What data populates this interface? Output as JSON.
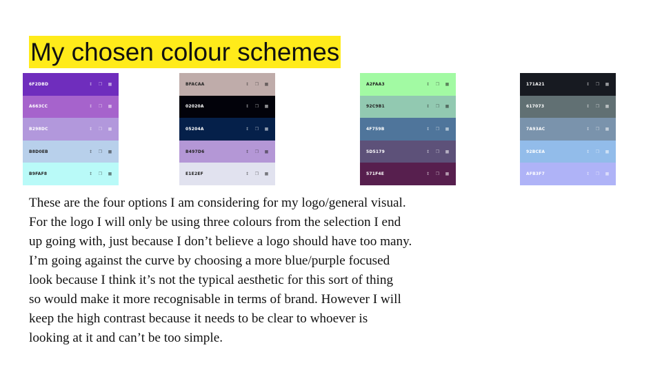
{
  "title": "My chosen colour schemes",
  "palettes": [
    {
      "swatches": [
        {
          "hex": "6F2DBD",
          "color": "#6F2DBD",
          "text": "#ffffff"
        },
        {
          "hex": "A663CC",
          "color": "#A663CC",
          "text": "#ffffff"
        },
        {
          "hex": "B298DC",
          "color": "#B298DC",
          "text": "#ffffff"
        },
        {
          "hex": "B8D0EB",
          "color": "#B8D0EB",
          "text": "#222222"
        },
        {
          "hex": "B9FAF8",
          "color": "#B9FAF8",
          "text": "#222222"
        }
      ]
    },
    {
      "swatches": [
        {
          "hex": "BFACAA",
          "color": "#BFACAA",
          "text": "#222222"
        },
        {
          "hex": "02020A",
          "color": "#02020A",
          "text": "#ffffff"
        },
        {
          "hex": "05204A",
          "color": "#05204A",
          "text": "#ffffff"
        },
        {
          "hex": "B497D6",
          "color": "#B497D6",
          "text": "#222222"
        },
        {
          "hex": "E1E2EF",
          "color": "#E1E2EF",
          "text": "#222222"
        }
      ]
    },
    {
      "swatches": [
        {
          "hex": "A2FAA3",
          "color": "#A2FAA3",
          "text": "#222222"
        },
        {
          "hex": "92C9B1",
          "color": "#92C9B1",
          "text": "#222222"
        },
        {
          "hex": "4F759B",
          "color": "#4F759B",
          "text": "#ffffff"
        },
        {
          "hex": "5D5179",
          "color": "#5D5179",
          "text": "#ffffff"
        },
        {
          "hex": "571F4E",
          "color": "#571F4E",
          "text": "#ffffff"
        }
      ]
    },
    {
      "swatches": [
        {
          "hex": "171A21",
          "color": "#171A21",
          "text": "#ffffff"
        },
        {
          "hex": "617073",
          "color": "#617073",
          "text": "#ffffff"
        },
        {
          "hex": "7A93AC",
          "color": "#7A93AC",
          "text": "#ffffff"
        },
        {
          "hex": "92BCEA",
          "color": "#92BCEA",
          "text": "#ffffff"
        },
        {
          "hex": "AFB3F7",
          "color": "#AFB3F7",
          "text": "#ffffff"
        }
      ]
    }
  ],
  "swatch_icons": [
    "drag-handle-icon",
    "copy-icon",
    "lock-icon"
  ],
  "body": [
    "These are the four options I am considering for my logo/general visual.",
    "For the logo I will only be using three colours from the selection I end",
    "up going with, just because I don’t believe a logo should have too many.",
    "I’m going against the curve by choosing a more blue/purple focused",
    "look because I think it’s not the typical aesthetic for this sort of thing",
    "so would make it more recognisable in terms of brand. However I will",
    "keep the high contrast because it needs to be clear to whoever is",
    "looking at it and can’t be too simple."
  ]
}
